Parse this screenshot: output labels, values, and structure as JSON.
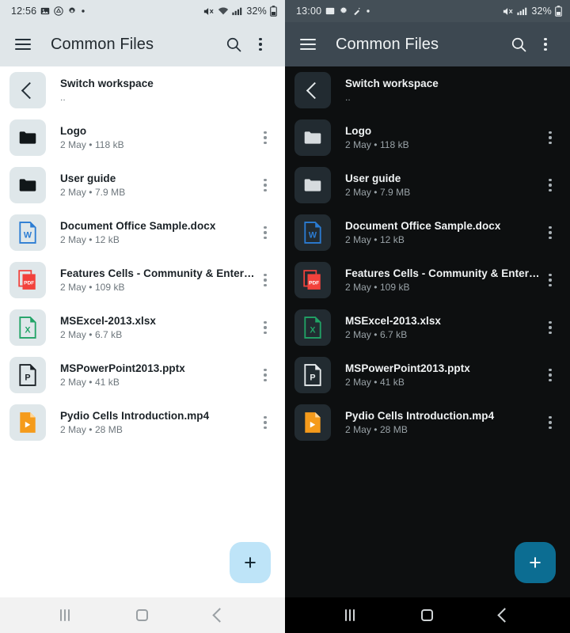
{
  "panels": [
    {
      "theme": "light",
      "status": {
        "time": "12:56",
        "left_icons": [
          "image-icon",
          "drive-icon",
          "gear-icon",
          "dot-icon"
        ],
        "right_icons": [
          "mute-icon",
          "wifi-icon",
          "signal-icon"
        ],
        "battery_percent": "32%",
        "battery_icon": "battery-icon"
      },
      "appbar": {
        "menu_icon": "hamburger-icon",
        "title": "Common Files",
        "search_icon": "search-icon",
        "overflow_icon": "kebab-menu-icon"
      },
      "workspace": {
        "label": "Switch workspace",
        "sub": "..",
        "icon": "back-chevron-icon"
      },
      "fab": {
        "label": "+",
        "name": "add-fab"
      },
      "navbar": {
        "recent": "recent-apps-icon",
        "home": "home-icon",
        "back": "back-icon"
      }
    },
    {
      "theme": "dark",
      "status": {
        "time": "13:00",
        "left_icons": [
          "image-icon",
          "gear-icon",
          "wand-icon",
          "dot-icon"
        ],
        "right_icons": [
          "mute-icon",
          "signal-icon"
        ],
        "battery_percent": "32%",
        "battery_icon": "battery-icon"
      },
      "appbar": {
        "menu_icon": "hamburger-icon",
        "title": "Common Files",
        "search_icon": "search-icon",
        "overflow_icon": "kebab-menu-icon"
      },
      "workspace": {
        "label": "Switch workspace",
        "sub": "..",
        "icon": "back-chevron-icon"
      },
      "fab": {
        "label": "+",
        "name": "add-fab"
      },
      "navbar": {
        "recent": "recent-apps-icon",
        "home": "home-icon",
        "back": "back-icon"
      }
    }
  ],
  "files": [
    {
      "name": "Logo",
      "meta": "2 May • 118 kB",
      "kind": "folder"
    },
    {
      "name": "User guide",
      "meta": "2 May • 7.9 MB",
      "kind": "folder"
    },
    {
      "name": "Document Office Sample.docx",
      "meta": "2 May • 12 kB",
      "kind": "word"
    },
    {
      "name": "Features Cells - Community & Enterpr…",
      "meta": "2 May • 109 kB",
      "kind": "pdf"
    },
    {
      "name": "MSExcel-2013.xlsx",
      "meta": "2 May • 6.7 kB",
      "kind": "excel"
    },
    {
      "name": "MSPowerPoint2013.pptx",
      "meta": "2 May • 41 kB",
      "kind": "powerpoint"
    },
    {
      "name": "Pydio Cells Introduction.mp4",
      "meta": "2 May • 28 MB",
      "kind": "video"
    }
  ],
  "colors": {
    "light_appbar": "#e0e6e9",
    "light_tile": "#dfe7ea",
    "light_fab": "#bee4f8",
    "dark_appbar": "#3d4851",
    "dark_tile": "#222b31",
    "dark_fab": "#0c6d92",
    "word": "#2b7cd3",
    "pdf": "#f2423c",
    "excel": "#21a366",
    "powerpoint": "#1b2227",
    "video": "#f59b1b"
  }
}
